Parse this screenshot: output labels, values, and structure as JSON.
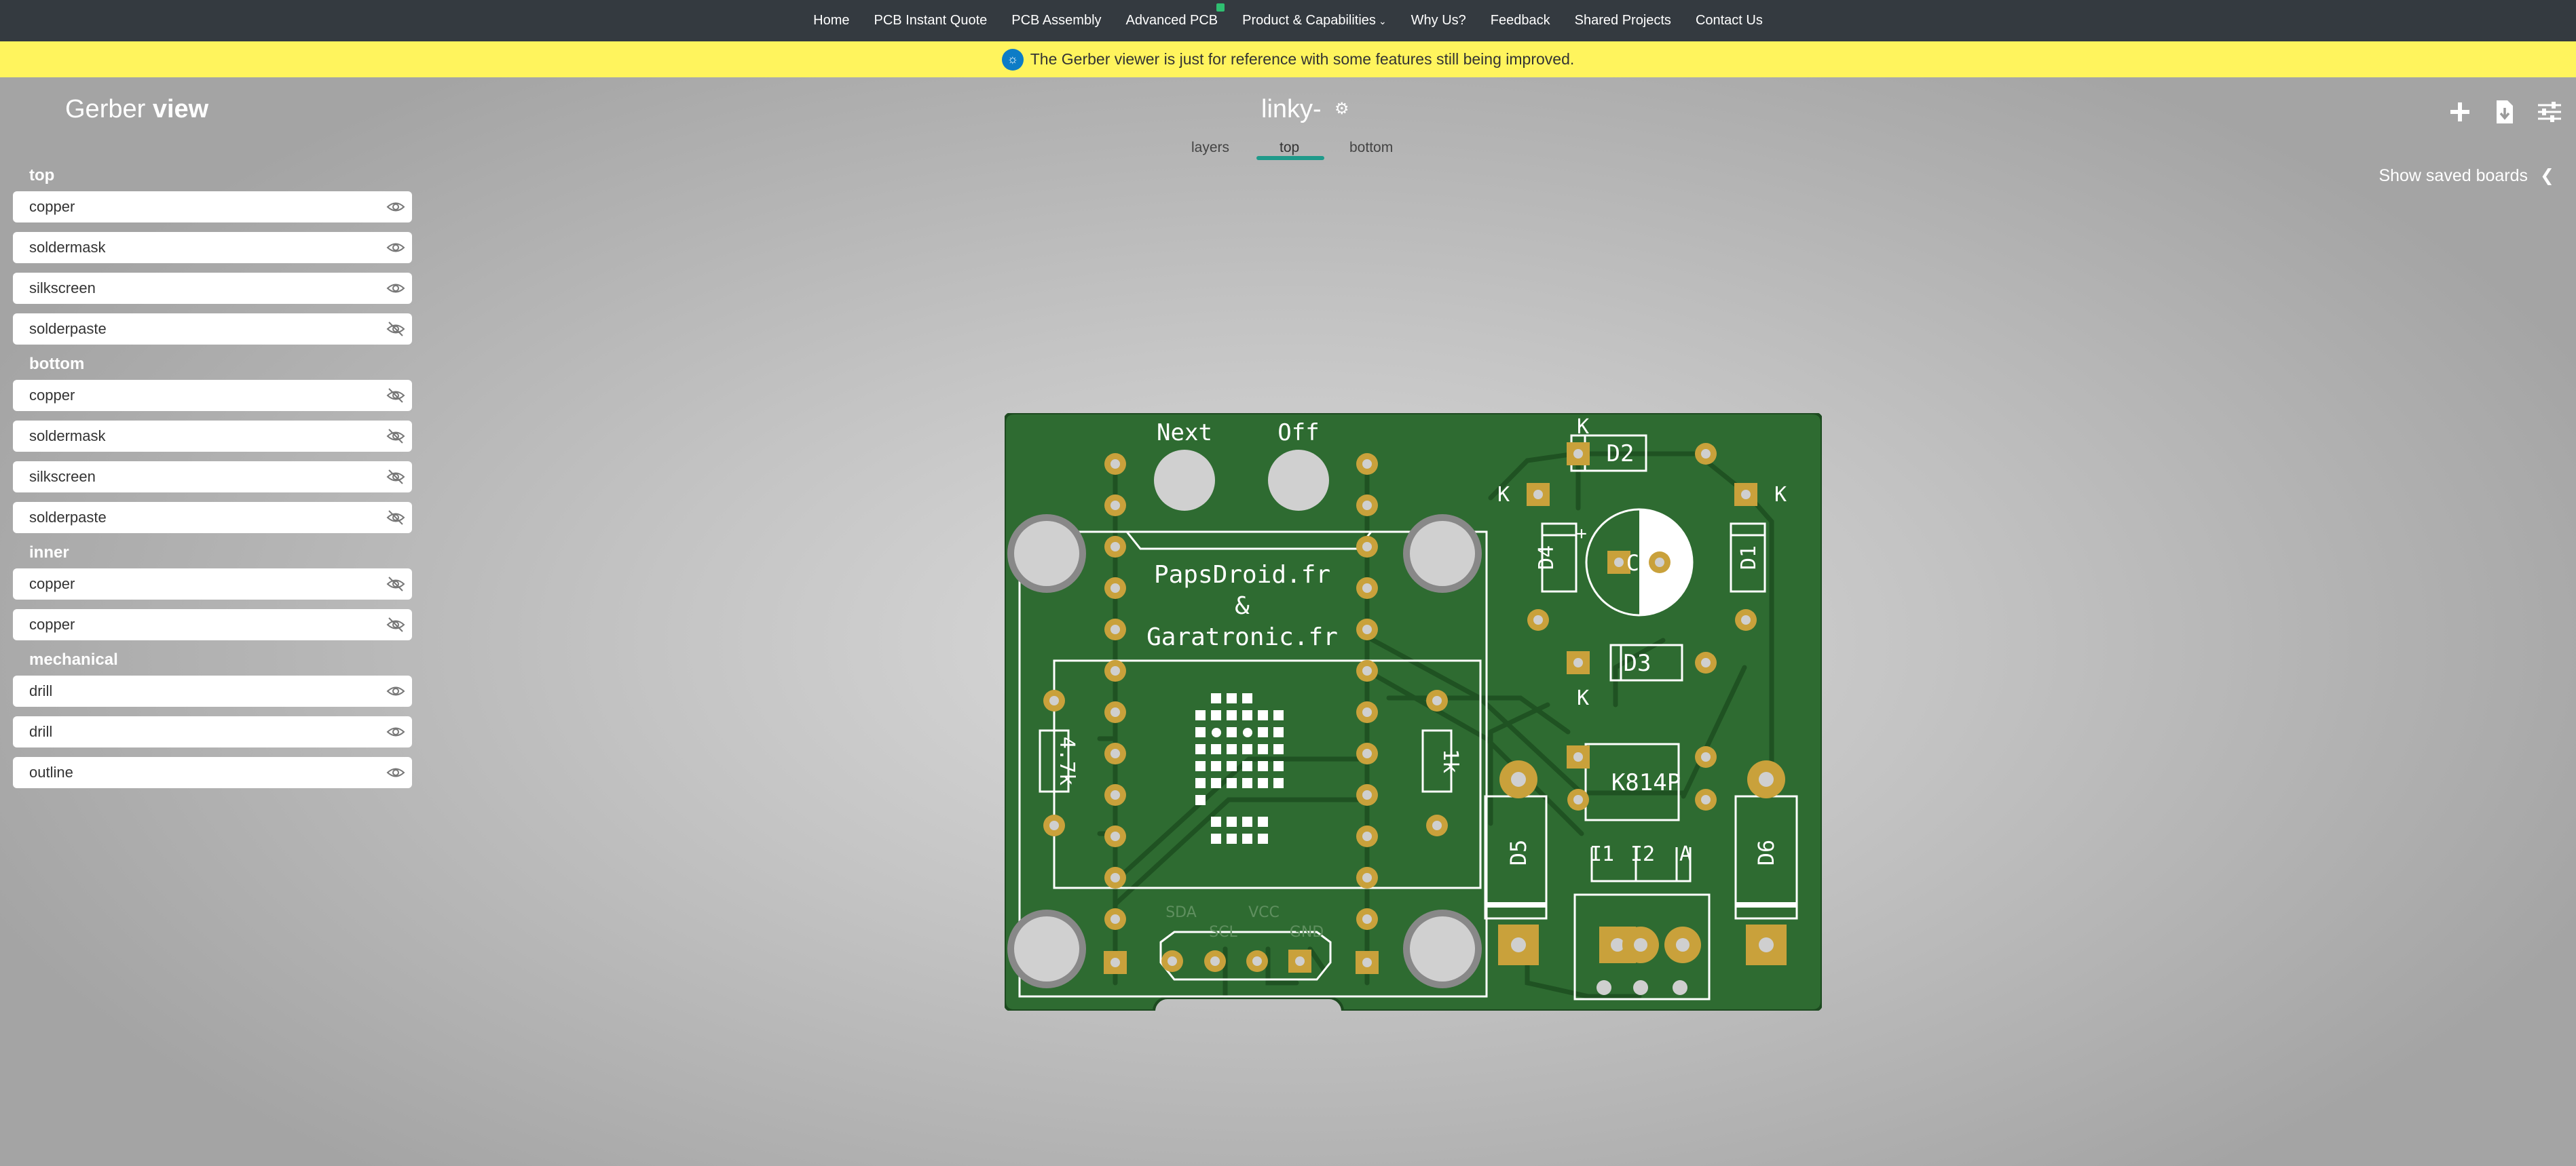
{
  "nav": {
    "items": [
      "Home",
      "PCB Instant Quote",
      "PCB Assembly",
      "Advanced PCB",
      "Product & Capabilities",
      "Why Us?",
      "Feedback",
      "Shared Projects",
      "Contact Us"
    ]
  },
  "notice": {
    "text": "The Gerber viewer is just for reference with some features still being improved."
  },
  "header": {
    "brand_light": "Gerber ",
    "brand_bold": "view",
    "board_name": "linky-",
    "tabs": [
      "layers",
      "top",
      "bottom"
    ],
    "active_tab": "top",
    "icons": [
      "plus-icon",
      "download-file-icon",
      "sliders-icon"
    ],
    "saved_boards": "Show saved boards"
  },
  "layer_groups": [
    {
      "name": "top",
      "layers": [
        {
          "label": "copper",
          "visible": true
        },
        {
          "label": "soldermask",
          "visible": true
        },
        {
          "label": "silkscreen",
          "visible": true
        },
        {
          "label": "solderpaste",
          "visible": false
        }
      ]
    },
    {
      "name": "bottom",
      "layers": [
        {
          "label": "copper",
          "visible": false
        },
        {
          "label": "soldermask",
          "visible": false
        },
        {
          "label": "silkscreen",
          "visible": false
        },
        {
          "label": "solderpaste",
          "visible": false
        }
      ]
    },
    {
      "name": "inner",
      "layers": [
        {
          "label": "copper",
          "visible": false
        },
        {
          "label": "copper",
          "visible": false
        }
      ]
    },
    {
      "name": "mechanical",
      "layers": [
        {
          "label": "drill",
          "visible": true
        },
        {
          "label": "drill",
          "visible": true
        },
        {
          "label": "outline",
          "visible": true
        }
      ]
    }
  ],
  "pcb": {
    "silkscreen": {
      "btn_next": "Next",
      "btn_off": "Off",
      "line1": "PapsDroid.fr",
      "line2": "&",
      "line3": "Garatronic.fr",
      "r1": "4.7k",
      "r2": "1k",
      "d1": "D1",
      "d2": "D2",
      "d3": "D3",
      "d4": "D4",
      "d5": "D5",
      "d6": "D6",
      "c1": "C1",
      "k": "K",
      "ic": "K814P",
      "i1": "I1",
      "i2": "I2",
      "a": "A",
      "sda": "SDA",
      "scl": "SCL",
      "vcc": "VCC",
      "gnd": "GND",
      "plus": "+"
    },
    "colors": {
      "board": "#2e6b31",
      "trace": "#1f5222",
      "pad": "#c9a13b",
      "silk": "#ffffff"
    }
  }
}
